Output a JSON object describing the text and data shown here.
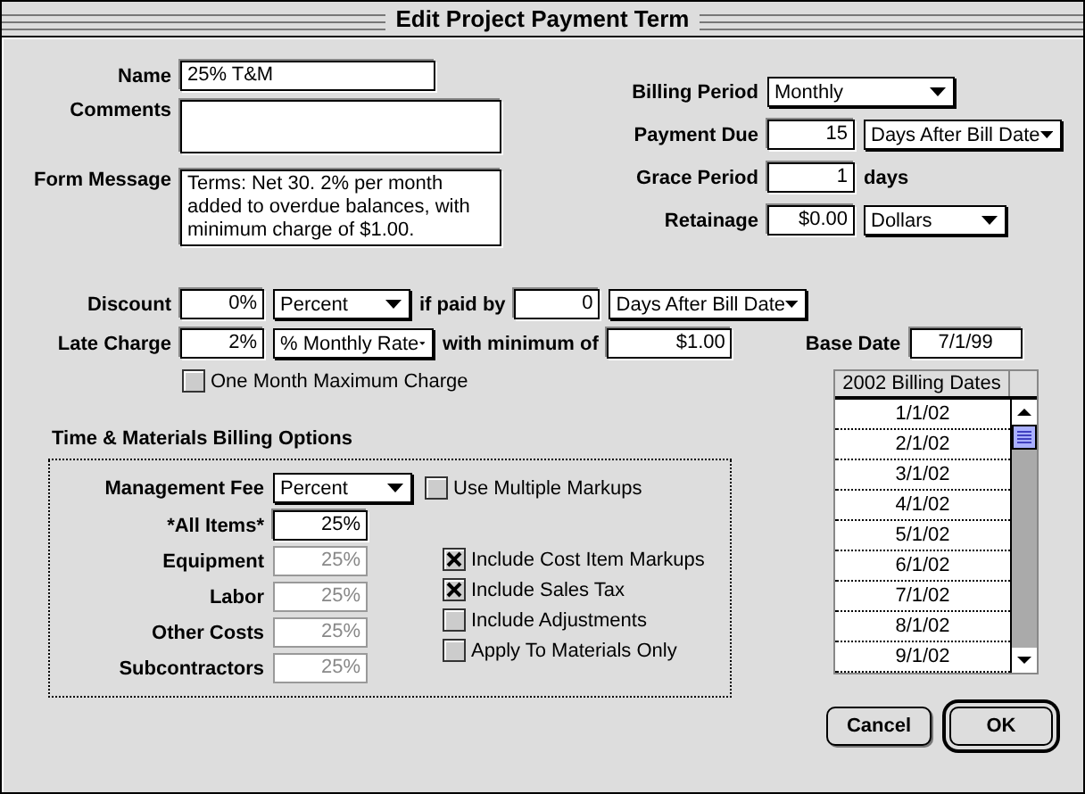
{
  "window": {
    "title": "Edit Project Payment Term"
  },
  "name": {
    "label": "Name",
    "value": "25% T&M"
  },
  "comments": {
    "label": "Comments"
  },
  "form_message": {
    "label": "Form Message",
    "value": "Terms: Net 30.  2% per month added to overdue balances, with minimum charge of $1.00."
  },
  "billing_period": {
    "label": "Billing Period",
    "value": "Monthly"
  },
  "payment_due": {
    "label": "Payment Due",
    "value": "15",
    "unit": "Days After Bill Date"
  },
  "grace_period": {
    "label": "Grace Period",
    "value": "1",
    "unit": "days"
  },
  "retainage": {
    "label": "Retainage",
    "value": "$0.00",
    "unit": "Dollars"
  },
  "discount": {
    "label": "Discount",
    "value": "0%",
    "unit": "Percent",
    "connector": "if paid by",
    "days": "0",
    "days_unit": "Days After Bill Date"
  },
  "late_charge": {
    "label": "Late Charge",
    "value": "2%",
    "unit": "% Monthly Rate",
    "connector": "with minimum of",
    "minimum": "$1.00"
  },
  "base_date": {
    "label": "Base Date",
    "value": "7/1/99"
  },
  "one_month_max": {
    "label": "One Month Maximum Charge",
    "checked": false
  },
  "tm_options": {
    "title": "Time & Materials Billing Options",
    "management_fee": {
      "label": "Management Fee",
      "value": "Percent"
    },
    "use_multiple_markups": {
      "label": "Use Multiple Markups",
      "checked": false
    },
    "markups": [
      {
        "label": "*All Items*",
        "value": "25%",
        "disabled": false
      },
      {
        "label": "Equipment",
        "value": "25%",
        "disabled": true
      },
      {
        "label": "Labor",
        "value": "25%",
        "disabled": true
      },
      {
        "label": "Other Costs",
        "value": "25%",
        "disabled": true
      },
      {
        "label": "Subcontractors",
        "value": "25%",
        "disabled": true
      }
    ],
    "options": [
      {
        "label": "Include Cost Item Markups",
        "checked": true
      },
      {
        "label": "Include Sales Tax",
        "checked": true
      },
      {
        "label": "Include Adjustments",
        "checked": false
      },
      {
        "label": "Apply To Materials Only",
        "checked": false
      }
    ]
  },
  "billing_dates": {
    "header": "2002 Billing Dates",
    "dates": [
      "1/1/02",
      "2/1/02",
      "3/1/02",
      "4/1/02",
      "5/1/02",
      "6/1/02",
      "7/1/02",
      "8/1/02",
      "9/1/02"
    ]
  },
  "buttons": [
    {
      "label": "Cancel",
      "default": false
    },
    {
      "label": "OK",
      "default": true
    }
  ]
}
